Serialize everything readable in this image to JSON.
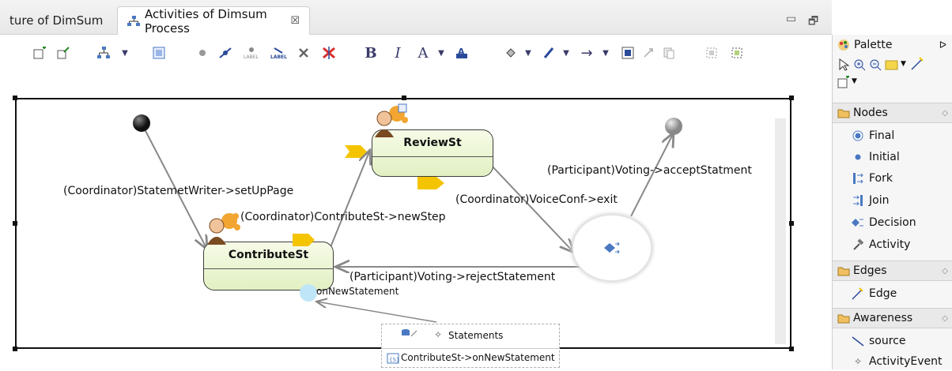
{
  "tabs": {
    "previous": "ture of DimSum",
    "active": "Activities of Dimsum Process",
    "close_glyph": "☒"
  },
  "window_controls": {
    "minimize": "▭",
    "maximize": "🗗"
  },
  "toolbar": {
    "bold": "B",
    "italic": "I",
    "font_color": "A",
    "dropdown": "▼",
    "arrow": "→"
  },
  "diagram": {
    "states": {
      "review": "ReviewSt",
      "contribute": "ContributeSt"
    },
    "transitions": {
      "setup": "(Coordinator)StatemetWriter->setUpPage",
      "newstep": "(Coordinator)ContributeSt->newStep",
      "exit": "(Coordinator)VoiceConf->exit",
      "accept": "(Participant)Voting->acceptStatment",
      "reject": "(Participant)Voting->rejectStatement"
    },
    "event_label": "onNewStatement",
    "artifact": {
      "title": "Statements",
      "item": "ContributeSt->onNewStatement"
    }
  },
  "palette": {
    "title": "Palette",
    "drawers": {
      "nodes": {
        "label": "Nodes",
        "items": [
          "Final",
          "Initial",
          "Fork",
          "Join",
          "Decision",
          "Activity"
        ]
      },
      "edges": {
        "label": "Edges",
        "items": [
          "Edge"
        ]
      },
      "awareness": {
        "label": "Awareness",
        "items": [
          "source",
          "ActivityEvent"
        ]
      }
    }
  },
  "colors": {
    "state_fill": "#e2f0c3",
    "link_gray": "#888888",
    "accent_blue": "#4a78c2",
    "orange": "#f2a530",
    "yellow": "#f5c400"
  }
}
